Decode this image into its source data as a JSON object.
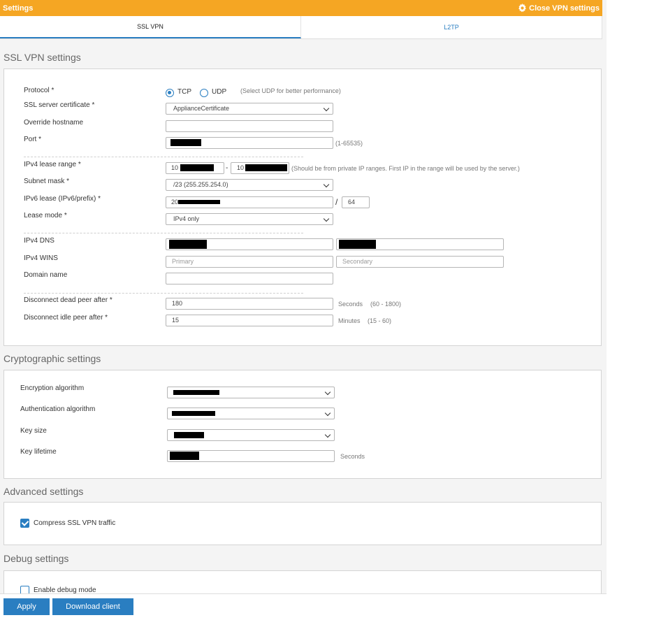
{
  "titlebar": {
    "title": "Settings",
    "close_label": "Close VPN settings"
  },
  "tabs": [
    {
      "label": "SSL VPN"
    },
    {
      "label": "L2TP"
    }
  ],
  "ssl": {
    "section_title": "SSL VPN settings",
    "protocol": {
      "label": "Protocol *",
      "tcp": "TCP",
      "udp": "UDP",
      "hint": "(Select UDP for better performance)",
      "selected": "TCP"
    },
    "certificate": {
      "label": "SSL server certificate *",
      "value": "ApplianceCertificate"
    },
    "override_hostname": {
      "label": "Override hostname",
      "value": ""
    },
    "port": {
      "label": "Port *",
      "hint": "(1-65535)"
    },
    "ipv4_lease": {
      "label": "IPv4 lease range *",
      "start_prefix": "10",
      "dash": "-",
      "end_prefix": "10",
      "hint": "(Should be from private IP ranges. First IP in the range will be used by the server.)"
    },
    "subnet_mask": {
      "label": "Subnet mask *",
      "value": "/23 (255.255.254.0)"
    },
    "ipv6_lease": {
      "label": "IPv6 lease (IPv6/prefix) *",
      "prefix_start": "20",
      "slash": "/",
      "prefix_len": "64"
    },
    "lease_mode": {
      "label": "Lease mode *",
      "value": "IPv4 only"
    },
    "ipv4_dns": {
      "label": "IPv4 DNS"
    },
    "ipv4_wins": {
      "label": "IPv4 WINS",
      "primary_placeholder": "Primary",
      "secondary_placeholder": "Secondary"
    },
    "domain_name": {
      "label": "Domain name",
      "value": ""
    },
    "dead_peer": {
      "label": "Disconnect dead peer after *",
      "value": "180",
      "unit": "Seconds",
      "range": "(60 - 1800)"
    },
    "idle_peer": {
      "label": "Disconnect idle peer after *",
      "value": "15",
      "unit": "Minutes",
      "range": "(15 - 60)"
    }
  },
  "crypto": {
    "section_title": "Cryptographic settings",
    "encryption": {
      "label": "Encryption algorithm"
    },
    "authentication": {
      "label": "Authentication algorithm"
    },
    "key_size": {
      "label": "Key size"
    },
    "key_lifetime": {
      "label": "Key lifetime",
      "unit": "Seconds"
    }
  },
  "advanced": {
    "section_title": "Advanced settings",
    "compress_label": "Compress SSL VPN traffic",
    "compress_checked": true
  },
  "debug": {
    "section_title": "Debug settings",
    "debug_label": "Enable debug mode",
    "debug_checked": false
  },
  "footer": {
    "apply_label": "Apply",
    "download_label": "Download client"
  },
  "colors": {
    "accent": "#2a7ec1",
    "titlebar": "#f5a623"
  }
}
